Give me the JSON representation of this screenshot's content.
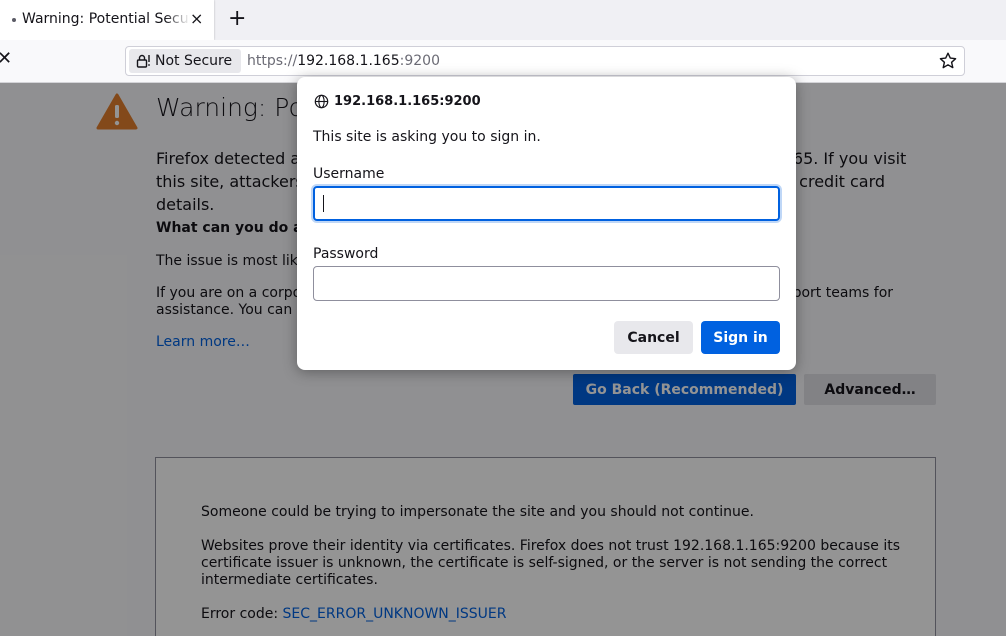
{
  "browser": {
    "tab": {
      "title": "Warning: Potential Security Risk Ahead",
      "close_glyph": "×"
    },
    "new_tab_glyph": "+",
    "nav_close_glyph": "✕",
    "urlbar": {
      "security_label": "Not Secure",
      "url_scheme": "https://",
      "url_host": "192.168.1.165",
      "url_port": ":9200",
      "icons": {
        "lock": "lock-warning-icon",
        "star": "bookmark-star-icon"
      }
    }
  },
  "page": {
    "title": "Warning: Potential Security Risk Ahead",
    "body": "Firefox detected a potential security threat and did not continue to 192.168.1.165. If you visit this site, attackers could try to steal information like your passwords, emails, or credit card details.",
    "what_heading": "What can you do about it?",
    "issue_text": "The issue is most likely with the website, and there is nothing you can do to resolve it.",
    "corporate_text": "If you are on a corporate network or using antivirus software, you can reach out to the support teams for assistance. You can also notify the website's administrator about the problem.",
    "learn_more": "Learn more…",
    "go_back_label": "Go Back (Recommended)",
    "advanced_label": "Advanced…",
    "advanced_panel": {
      "p1": "Someone could be trying to impersonate the site and you should not continue.",
      "p2": "Websites prove their identity via certificates. Firefox does not trust 192.168.1.165:9200 because its certificate issuer is unknown, the certificate is self-signed, or the server is not sending the correct intermediate certificates.",
      "error_prefix": "Error code: ",
      "error_code": "SEC_ERROR_UNKNOWN_ISSUER"
    },
    "accent_color": "#0061e0",
    "warning_color": "#e27f2e"
  },
  "dialog": {
    "host": "192.168.1.165:9200",
    "message": "This site is asking you to sign in.",
    "username_label": "Username",
    "username_value": "",
    "password_label": "Password",
    "password_value": "",
    "cancel_label": "Cancel",
    "signin_label": "Sign in"
  }
}
